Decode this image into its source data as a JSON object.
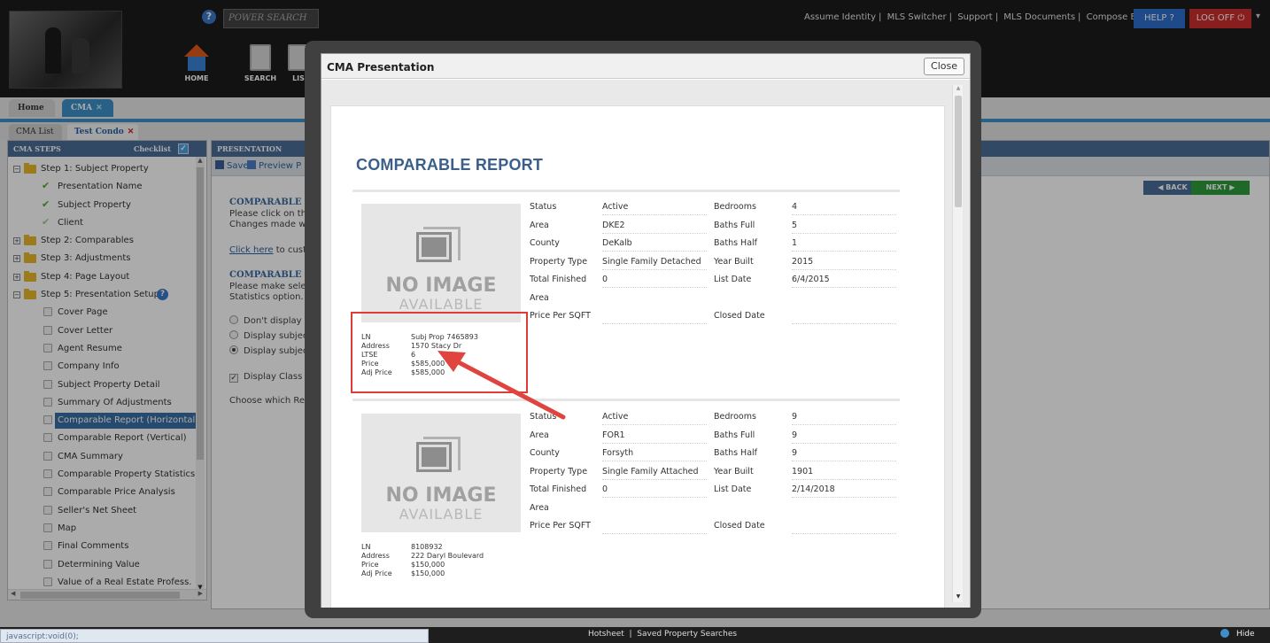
{
  "header": {
    "power_search_placeholder": "POWER SEARCH",
    "top_links": [
      "Assume Identity",
      "MLS Switcher",
      "Support",
      "MLS Documents",
      "Compose Email"
    ],
    "help_label": "HELP",
    "logoff_label": "LOG OFF",
    "nav": [
      {
        "label": "HOME",
        "icon": "home-icon"
      },
      {
        "label": "SEARCH",
        "icon": "search-doc-icon"
      },
      {
        "label": "LIS",
        "icon": "list-icon"
      }
    ]
  },
  "tabs": {
    "main": [
      {
        "label": "Home"
      },
      {
        "label": "CMA"
      }
    ],
    "sub": [
      {
        "label": "CMA List"
      },
      {
        "label": "Test Condo"
      }
    ]
  },
  "left_panel": {
    "title": "CMA STEPS",
    "checklist_label": "Checklist",
    "steps": [
      {
        "label": "Step 1: Subject Property",
        "type": "folder",
        "expanded": true
      },
      {
        "label": "Presentation Name",
        "type": "done"
      },
      {
        "label": "Subject Property",
        "type": "done"
      },
      {
        "label": "Client",
        "type": "partial"
      },
      {
        "label": "Step 2: Comparables",
        "type": "folder",
        "expanded": false
      },
      {
        "label": "Step 3: Adjustments",
        "type": "folder",
        "expanded": false
      },
      {
        "label": "Step 4: Page Layout",
        "type": "folder",
        "expanded": false
      },
      {
        "label": "Step 5: Presentation Setup",
        "type": "folder",
        "expanded": true
      },
      {
        "label": "Cover Page",
        "type": "checkbox"
      },
      {
        "label": "Cover Letter",
        "type": "checkbox"
      },
      {
        "label": "Agent Resume",
        "type": "checkbox"
      },
      {
        "label": "Company Info",
        "type": "checkbox"
      },
      {
        "label": "Subject Property Detail",
        "type": "checkbox"
      },
      {
        "label": "Summary Of Adjustments",
        "type": "checkbox"
      },
      {
        "label": "Comparable Report (Horizontal)",
        "type": "checkbox",
        "selected": true
      },
      {
        "label": "Comparable Report (Vertical)",
        "type": "checkbox"
      },
      {
        "label": "CMA Summary",
        "type": "checkbox"
      },
      {
        "label": "Comparable Property Statistics",
        "type": "checkbox"
      },
      {
        "label": "Comparable Price Analysis",
        "type": "checkbox"
      },
      {
        "label": "Seller's Net Sheet",
        "type": "checkbox"
      },
      {
        "label": "Map",
        "type": "checkbox"
      },
      {
        "label": "Final Comments",
        "type": "checkbox"
      },
      {
        "label": "Determining Value",
        "type": "checkbox"
      },
      {
        "label": "Value of a Real Estate Profess.",
        "type": "checkbox"
      }
    ]
  },
  "main_panel": {
    "title": "PRESENTATION",
    "save_label": "Save",
    "preview_label": "Preview P",
    "back_label": "BACK",
    "next_label": "NEXT",
    "heading1": "COMPARABLE RE",
    "line1": "Please click on the",
    "line2": "Changes made will",
    "click_here": "Click here",
    "click_here_rest": " to custo",
    "heading2": "COMPARABLE RE",
    "line3": "Please make select",
    "line4": "Statistics option.",
    "radio1": "Don't display th",
    "radio2": "Display subject",
    "radio3": "Display subject",
    "checkbox1": "Display Class S",
    "choose_text": "Choose which Rem"
  },
  "modal": {
    "title": "CMA Presentation",
    "close_label": "Close",
    "report_title": "COMPARABLE REPORT",
    "no_image_line1": "NO IMAGE",
    "no_image_line2": "AVAILABLE",
    "properties": [
      {
        "info": [
          {
            "k": "LN",
            "v": "Subj Prop 7465893"
          },
          {
            "k": "Address",
            "v": "1570 Stacy Dr"
          },
          {
            "k": "LTSE",
            "v": "6"
          },
          {
            "k": "Price",
            "v": "$585,000"
          },
          {
            "k": "Adj Price",
            "v": "$585,000"
          }
        ],
        "fields": {
          "status": "Active",
          "bedrooms": "4",
          "area": "DKE2",
          "baths_full": "5",
          "county": "DeKalb",
          "baths_half": "1",
          "property_type": "Single Family Detached",
          "year_built": "2015",
          "total_finished": "0",
          "list_date": "6/4/2015",
          "price_per_sqft": "",
          "closed_date": ""
        }
      },
      {
        "info": [
          {
            "k": "LN",
            "v": "8108932"
          },
          {
            "k": "Address",
            "v": "222 Daryl Boulevard"
          },
          {
            "k": "Price",
            "v": "$150,000"
          },
          {
            "k": "Adj Price",
            "v": "$150,000"
          }
        ],
        "fields": {
          "status": "Active",
          "bedrooms": "9",
          "area": "FOR1",
          "baths_full": "9",
          "county": "Forsyth",
          "baths_half": "9",
          "property_type": "Single Family Attached",
          "year_built": "1901",
          "total_finished": "0",
          "list_date": "2/14/2018",
          "price_per_sqft": "",
          "closed_date": ""
        }
      }
    ],
    "field_labels": {
      "status": "Status",
      "area": "Area",
      "county": "County",
      "property_type": "Property Type",
      "total_finished": "Total Finished",
      "area2": "Area",
      "price_per_sqft": "Price Per SQFT",
      "bedrooms": "Bedrooms",
      "baths_full": "Baths Full",
      "baths_half": "Baths Half",
      "year_built": "Year Built",
      "list_date": "List Date",
      "closed_date": "Closed Date"
    }
  },
  "status_bar": {
    "url": "javascript:void(0);",
    "links": [
      "Hotsheet",
      "Saved Property Searches"
    ],
    "hide_label": "Hide"
  },
  "colors": {
    "accent_blue": "#3e8fc8",
    "header_dark": "#1b1b1b",
    "panel_head": "#4b6e98",
    "report_title": "#3a5f8a",
    "annotation_red": "#e03b3b",
    "logoff_red": "#cc2e2e",
    "next_green": "#2f9d3c"
  }
}
